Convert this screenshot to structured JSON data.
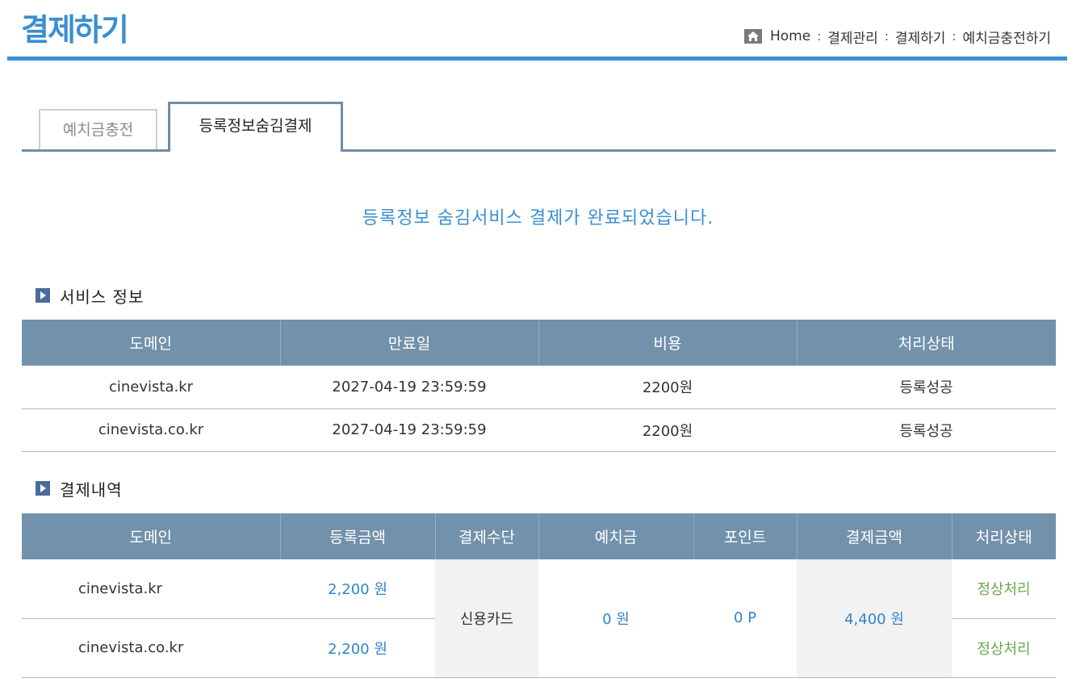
{
  "header": {
    "title": "결제하기",
    "breadcrumb": [
      "Home",
      "결제관리",
      "결제하기",
      "예치금충전하기"
    ],
    "separator": ":"
  },
  "tabs": [
    {
      "label": "예치금충전",
      "active": false
    },
    {
      "label": "등록정보숨김결제",
      "active": true
    }
  ],
  "notice": "등록정보 숨김서비스 결제가 완료되었습니다.",
  "service_info": {
    "title": "서비스 정보",
    "headers": [
      "도메인",
      "만료일",
      "비용",
      "처리상태"
    ],
    "rows": [
      {
        "domain": "cinevista.kr",
        "expiry": "2027-04-19 23:59:59",
        "cost": "2200원",
        "status": "등록성공"
      },
      {
        "domain": "cinevista.co.kr",
        "expiry": "2027-04-19 23:59:59",
        "cost": "2200원",
        "status": "등록성공"
      }
    ]
  },
  "payment": {
    "title": "결제내역",
    "headers": [
      "도메인",
      "등록금액",
      "결제수단",
      "예치금",
      "포인트",
      "결제금액",
      "처리상태"
    ],
    "rows": [
      {
        "domain": "cinevista.kr",
        "amount": "2,200 원",
        "status": "정상처리"
      },
      {
        "domain": "cinevista.co.kr",
        "amount": "2,200 원",
        "status": "정상처리"
      }
    ],
    "method": "신용카드",
    "deposit": "0 원",
    "points": "0 P",
    "total": "4,400 원"
  },
  "colors": {
    "accent": "#3a8fd0",
    "table_header": "#7291ab",
    "status_ok": "#6aa84f"
  }
}
